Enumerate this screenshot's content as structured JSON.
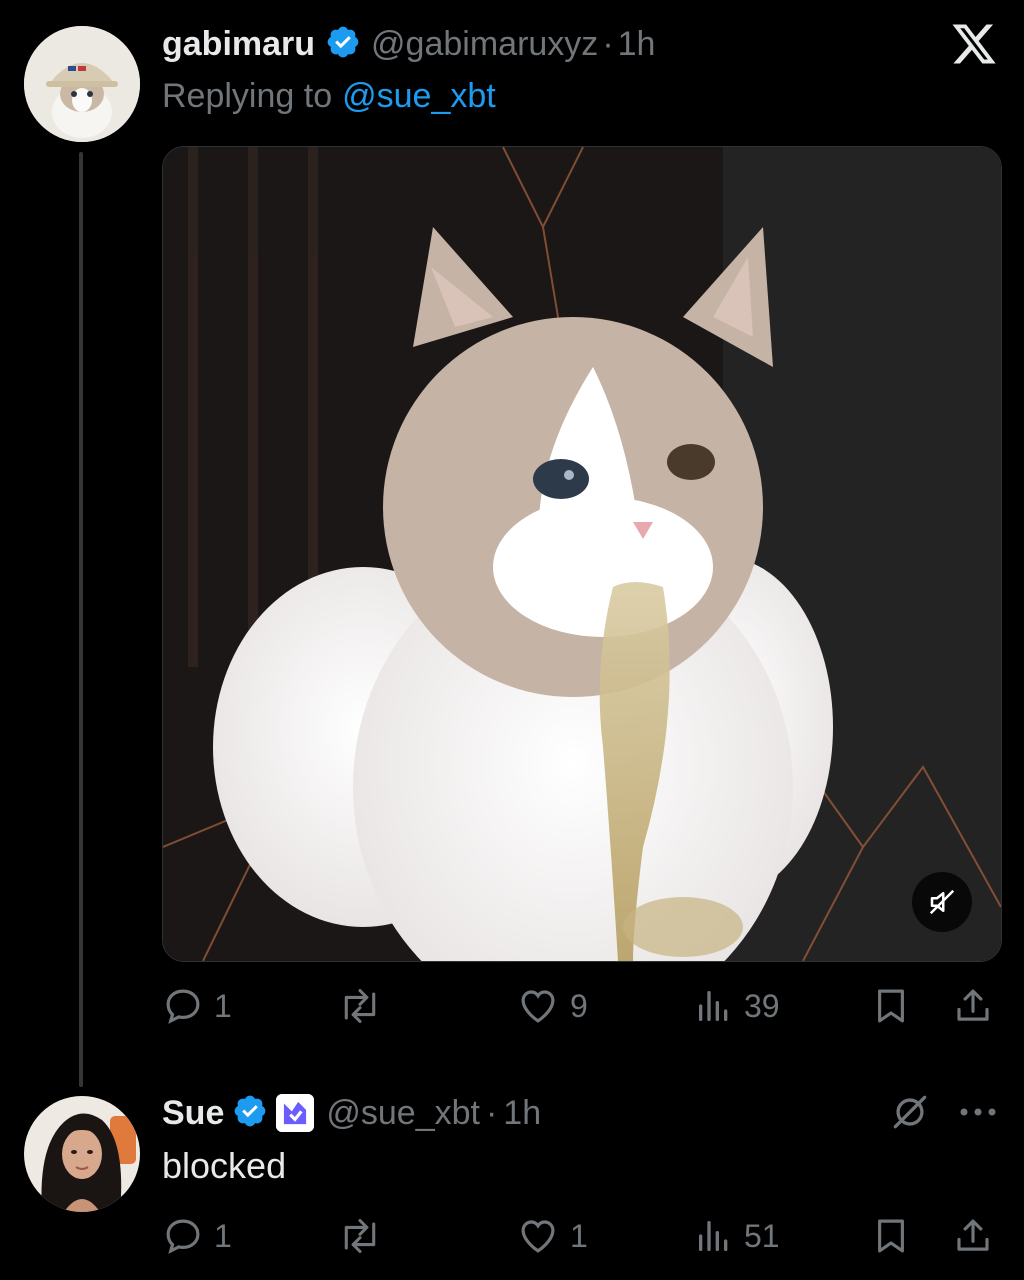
{
  "tweet": {
    "author_name": "gabimaru",
    "handle": "@gabimaruxyz",
    "separator": "·",
    "time": "1h",
    "replying_prefix": "Replying to",
    "replying_to": "@sue_xbt",
    "actions": {
      "replies": "1",
      "reposts": "",
      "likes": "9",
      "views": "39"
    }
  },
  "reply": {
    "author_name": "Sue",
    "handle": "@sue_xbt",
    "separator": "·",
    "time": "1h",
    "text": "blocked",
    "actions": {
      "replies": "1",
      "reposts": "",
      "likes": "1",
      "views": "51"
    }
  },
  "colors": {
    "background": "#000000",
    "verified": "#1d9bf0",
    "link": "#1d9bf0",
    "secondary_text": "#71767b",
    "primary_text": "#e7e9ea"
  },
  "icons": {
    "logo": "x-logo-icon",
    "mute": "speaker-muted-icon",
    "reply": "comment-icon",
    "repost": "repost-icon",
    "like": "heart-icon",
    "views": "analytics-icon",
    "bookmark": "bookmark-icon",
    "share": "share-icon",
    "grok": "grok-icon",
    "more": "more-icon"
  }
}
